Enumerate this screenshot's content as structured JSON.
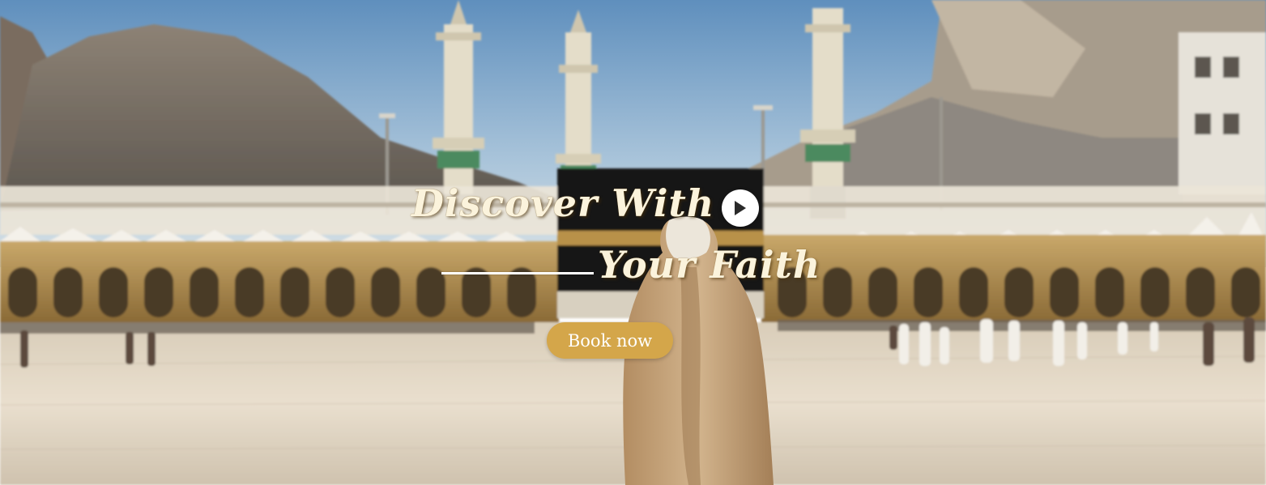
{
  "hero": {
    "headline_line1": "Discover With",
    "headline_line2": "Your Faith",
    "cta_label": "Book now"
  },
  "icons": {
    "play": "play-icon"
  },
  "colors": {
    "accent_gold": "#d4a64a",
    "headline_cream": "#fbf3dc",
    "sky": "#8fb3d4",
    "marble": "#e7dccb"
  }
}
